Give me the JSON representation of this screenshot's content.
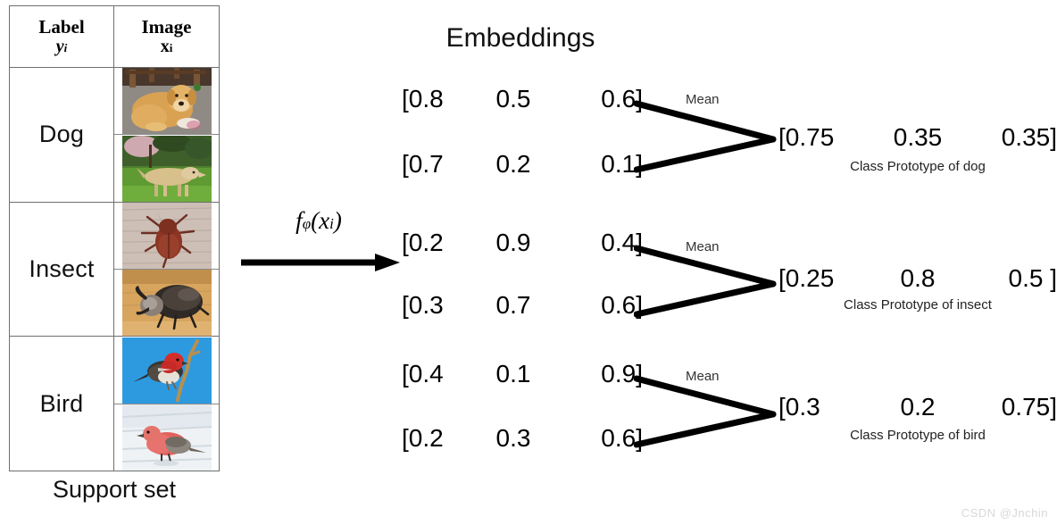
{
  "table": {
    "headers": {
      "label": {
        "line1": "Label",
        "line2": "y",
        "sub2": "i"
      },
      "image": {
        "line1": "Image",
        "line2": "x",
        "sub2": "i"
      }
    },
    "rows": [
      {
        "label": "Dog",
        "images": [
          {
            "name": "golden-retriever-puppy-indoors",
            "alt": "Golden retriever puppy lying on carpet"
          },
          {
            "name": "golden-retriever-on-grass",
            "alt": "Golden retriever walking on green grass"
          }
        ]
      },
      {
        "label": "Insect",
        "images": [
          {
            "name": "red-beetle-on-stone",
            "alt": "Reddish brown beetle on light stone"
          },
          {
            "name": "rhinoceros-beetle-on-wood",
            "alt": "Dark rhinoceros beetle on tan wood"
          }
        ]
      },
      {
        "label": "Bird",
        "images": [
          {
            "name": "red-finch-on-branch",
            "alt": "Red finch perched on branch against blue sky"
          },
          {
            "name": "red-finch-on-snow",
            "alt": "Red finch standing on white snow"
          }
        ]
      }
    ],
    "caption": "Support set"
  },
  "transform": {
    "function_label": {
      "f": "f",
      "phi": "φ",
      "open": "(",
      "x": "x",
      "sub": "i",
      "close": ")"
    },
    "arrow_name": "embedding-function-arrow"
  },
  "embeddings": {
    "title": "Embeddings",
    "mean_label": "Mean",
    "groups": [
      {
        "class": "dog",
        "vectors": [
          {
            "c0": "[0.8",
            "c1": "0.5",
            "c2": "0.6]"
          },
          {
            "c0": "[0.7",
            "c1": "0.2",
            "c2": "0.1]"
          }
        ],
        "prototype": {
          "p0": "[0.75",
          "p1": "0.35",
          "p2": "0.35]"
        },
        "prototype_caption": "Class Prototype of dog"
      },
      {
        "class": "insect",
        "vectors": [
          {
            "c0": "[0.2",
            "c1": "0.9",
            "c2": "0.4]"
          },
          {
            "c0": "[0.3",
            "c1": "0.7",
            "c2": "0.6]"
          }
        ],
        "prototype": {
          "p0": "[0.25",
          "p1": "0.8",
          "p2": "0.5  ]"
        },
        "prototype_caption": "Class Prototype of insect"
      },
      {
        "class": "bird",
        "vectors": [
          {
            "c0": "[0.4",
            "c1": "0.1",
            "c2": "0.9]"
          },
          {
            "c0": "[0.2",
            "c1": "0.3",
            "c2": "0.6]"
          }
        ],
        "prototype": {
          "p0": "[0.3",
          "p1": "0.2",
          "p2": "0.75]"
        },
        "prototype_caption": "Class Prototype of bird"
      }
    ]
  },
  "watermark": "CSDN @Jnchin",
  "colors": {
    "line": "#000000",
    "table_border": "#6f6f6f",
    "text": "#111111",
    "watermark": "#d8d8d8"
  },
  "chart_data": {
    "type": "diagram",
    "title": "Prototypical network: support set to class prototypes",
    "categories": [
      "Dog",
      "Insect",
      "Bird"
    ],
    "series": [
      {
        "name": "dog embeddings",
        "values": [
          [
            0.8,
            0.5,
            0.6
          ],
          [
            0.7,
            0.2,
            0.1
          ]
        ],
        "prototype": [
          0.75,
          0.35,
          0.35
        ]
      },
      {
        "name": "insect embeddings",
        "values": [
          [
            0.2,
            0.9,
            0.4
          ],
          [
            0.3,
            0.7,
            0.6
          ]
        ],
        "prototype": [
          0.25,
          0.8,
          0.5
        ]
      },
      {
        "name": "bird embeddings",
        "values": [
          [
            0.4,
            0.1,
            0.9
          ],
          [
            0.2,
            0.3,
            0.6
          ]
        ],
        "prototype": [
          0.3,
          0.2,
          0.75
        ]
      }
    ]
  }
}
